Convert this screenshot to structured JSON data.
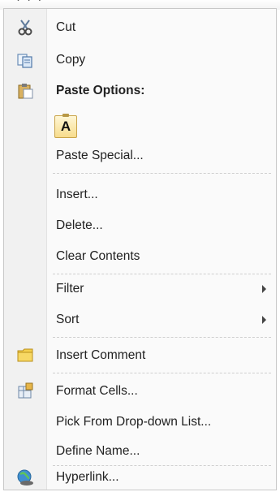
{
  "menu": {
    "items": [
      {
        "label": "Cut",
        "icon": "scissors-icon"
      },
      {
        "label": "Copy",
        "icon": "copy-icon"
      },
      {
        "label": "Paste Options:",
        "icon": "clipboard-icon"
      },
      {
        "label": "Paste Special..."
      },
      {
        "label": "Insert..."
      },
      {
        "label": "Delete..."
      },
      {
        "label": "Clear Contents"
      },
      {
        "label": "Filter",
        "submenu": true
      },
      {
        "label": "Sort",
        "submenu": true
      },
      {
        "label": "Insert Comment",
        "icon": "comment-icon"
      },
      {
        "label": "Format Cells...",
        "icon": "format-cells-icon"
      },
      {
        "label": "Pick From Drop-down List..."
      },
      {
        "label": "Define Name..."
      },
      {
        "label": "Hyperlink...",
        "icon": "hyperlink-icon"
      }
    ],
    "paste_option_glyph": "A"
  }
}
